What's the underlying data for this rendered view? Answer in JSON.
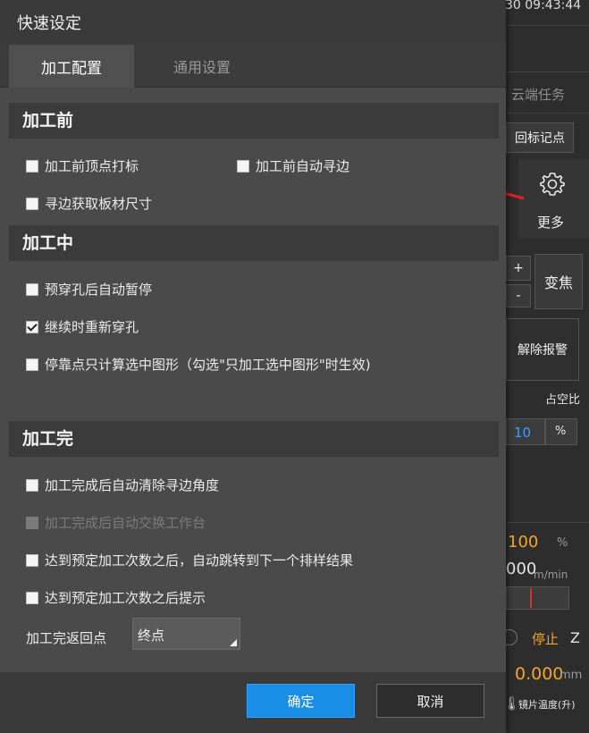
{
  "background": {
    "clock": "30 09:43:44",
    "cloud_tab": "云端任务",
    "return_mark_button": "回标记点",
    "more_label": "更多",
    "plus": "+",
    "minus": "-",
    "zoom_button": "变焦",
    "release_alarm_button": "解除报警",
    "duty_ratio_label": "占空比",
    "duty_ratio_value": "10",
    "percent": "%",
    "speed_percent": "100",
    "percent2": "%",
    "speed_value": "000",
    "speed_unit": "m/min",
    "stop_label": "停止",
    "axis_z": "Z",
    "z_value": "0.000",
    "z_unit": "mm",
    "lens_temp": "镜片温度(升)"
  },
  "dialog": {
    "title": "快速设定",
    "tabs": [
      {
        "label": "加工配置",
        "active": true
      },
      {
        "label": "通用设置",
        "active": false
      }
    ],
    "before": {
      "header": "加工前",
      "options": [
        {
          "label": "加工前顶点打标",
          "checked": false
        },
        {
          "label": "加工前自动寻边",
          "checked": false
        },
        {
          "label": "寻边获取板材尺寸",
          "checked": false
        }
      ]
    },
    "during": {
      "header": "加工中",
      "options": [
        {
          "label": "预穿孔后自动暂停",
          "checked": false
        },
        {
          "label": "继续时重新穿孔",
          "checked": true
        },
        {
          "label": "停靠点只计算选中图形（勾选\"只加工选中图形\"时生效)",
          "checked": false
        }
      ]
    },
    "after": {
      "header": "加工完",
      "options": [
        {
          "label": "加工完成后自动清除寻边角度",
          "checked": false
        },
        {
          "label": "加工完成后自动交换工作台",
          "checked": false,
          "disabled": true
        },
        {
          "label": "达到预定加工次数之后，自动跳转到下一个排样结果",
          "checked": false
        },
        {
          "label": "达到预定加工次数之后提示",
          "checked": false
        }
      ],
      "return_label": "加工完返回点",
      "return_value": "终点"
    },
    "ok_button": "确定",
    "cancel_button": "取消"
  },
  "colors": {
    "accent": "#1a8de6",
    "arrow": "#e02020",
    "orange": "#f5a623",
    "blue": "#3aa0ff"
  }
}
